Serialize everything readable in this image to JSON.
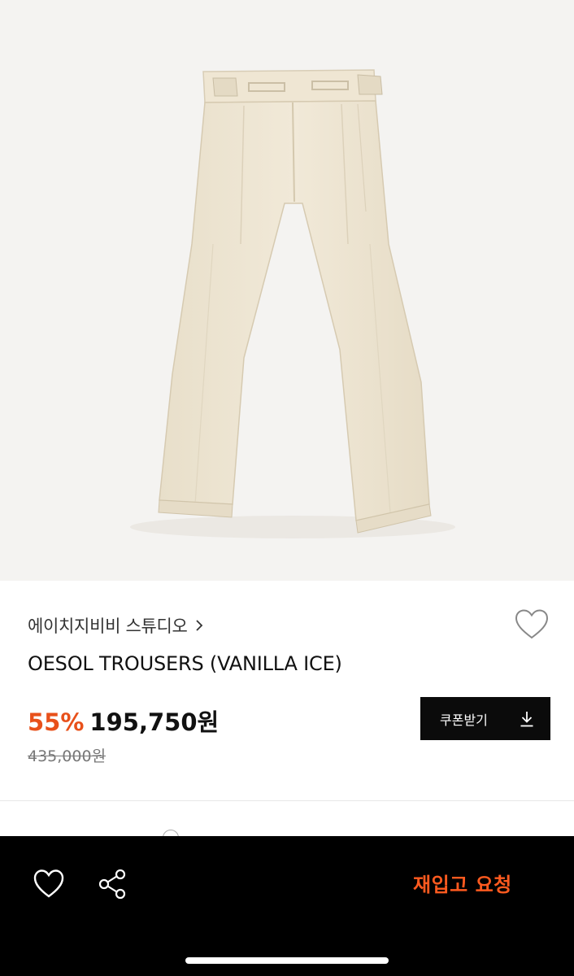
{
  "product": {
    "brand": "에이치지비비 스튜디오",
    "title": "OESOL TROUSERS (VANILLA ICE)",
    "discount": "55%",
    "price": "195,750원",
    "original_price": "435,000원",
    "image_alt": "OESOL TROUSERS product image"
  },
  "coupon": {
    "label": "쿠폰받기",
    "icon": "download-icon"
  },
  "bottom_bar": {
    "wishlist_icon": "heart-icon",
    "share_icon": "share-icon",
    "restock_label": "재입고 요청"
  },
  "colors": {
    "accent": "#e8501a",
    "restock": "#ff5a1f",
    "pants": "#efe6d3",
    "background": "#f4f3f1"
  }
}
